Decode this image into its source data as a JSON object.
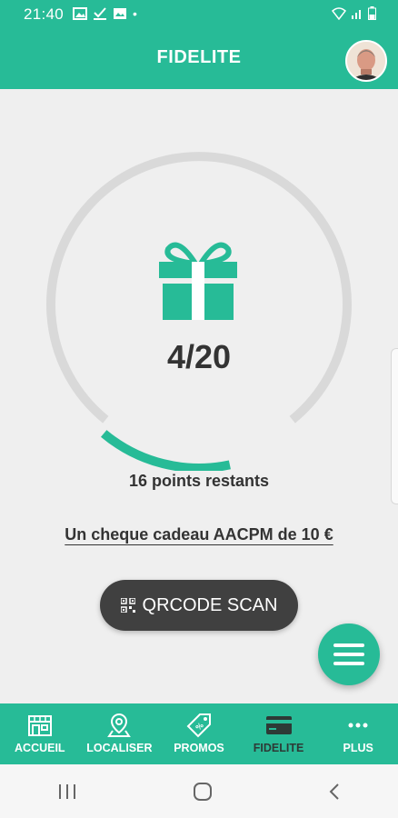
{
  "status_bar": {
    "time": "21:40"
  },
  "header": {
    "title": "FIDELITE"
  },
  "loyalty": {
    "current_points": 4,
    "target_points": 20,
    "progress_label": "4/20",
    "remaining_label": "16 points restants",
    "reward_label": "Un cheque cadeau AACPM de 10 €"
  },
  "qr_button": {
    "label": "QRCODE SCAN"
  },
  "bottom_nav": {
    "items": [
      {
        "label": "ACCUEIL",
        "icon": "storefront-icon"
      },
      {
        "label": "LOCALISER",
        "icon": "map-pin-icon"
      },
      {
        "label": "PROMOS",
        "icon": "price-tag-icon"
      },
      {
        "label": "FIDELITE",
        "icon": "credit-card-icon",
        "active": true
      },
      {
        "label": "PLUS",
        "icon": "more-dots-icon"
      }
    ]
  },
  "colors": {
    "accent": "#27bb97",
    "track": "#d9d9d9",
    "dark_button": "#404040",
    "text": "#333333"
  }
}
